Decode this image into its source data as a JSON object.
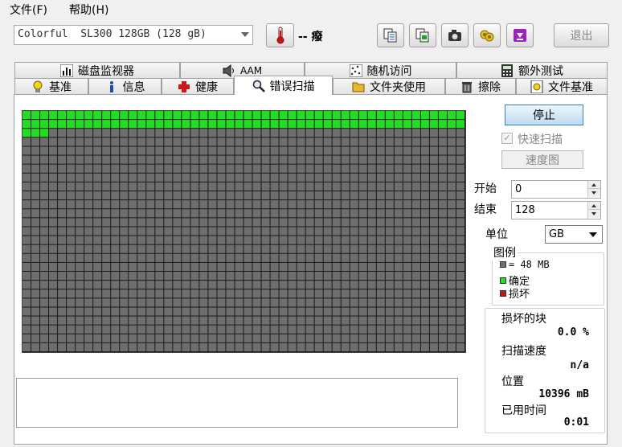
{
  "menu": {
    "file": "文件(F)",
    "help": "帮助(H)"
  },
  "toolbar": {
    "drive": "Colorful  SL300 128GB (128 gB)",
    "temperature": "-- 癈",
    "exit_label": "退出",
    "icons": [
      "thermometer-icon",
      "copy-text-icon",
      "copy-image-icon",
      "camera-icon",
      "options-icon",
      "download-icon"
    ]
  },
  "tabs_row1": [
    {
      "label": "磁盘监视器",
      "icon": "chart-icon"
    },
    {
      "label": "AAM",
      "icon": "speaker-icon"
    },
    {
      "label": "随机访问",
      "icon": "random-icon"
    },
    {
      "label": "额外测试",
      "icon": "calculator-icon"
    }
  ],
  "tabs_row2": [
    {
      "label": "基准",
      "icon": "lightbulb-icon"
    },
    {
      "label": "信息",
      "icon": "info-icon"
    },
    {
      "label": "健康",
      "icon": "health-cross-icon"
    },
    {
      "label": "错误扫描",
      "icon": "magnifier-icon",
      "active": true
    },
    {
      "label": "文件夹使用",
      "icon": "folder-icon"
    },
    {
      "label": "擦除",
      "icon": "trash-icon"
    },
    {
      "label": "文件基准",
      "icon": "file-benchmark-icon"
    }
  ],
  "scan": {
    "grid_columns": 50,
    "grid_rows": 27,
    "scanned_cells": 103,
    "colors": {
      "ok": "#22dd22",
      "pending": "#6e6e6e",
      "bad": "#cc1111",
      "line": "#1a1a1a"
    }
  },
  "controls": {
    "stop_label": "停止",
    "quick_scan_label": "快速扫描",
    "quick_scan_checked": true,
    "speed_map_label": "速度图",
    "start_label": "开始",
    "start_value": "0",
    "end_label": "结束",
    "end_value": "128",
    "unit_label": "单位",
    "unit_value": "GB"
  },
  "legend": {
    "title": "图例",
    "block_size": "= 48 MB",
    "ok": "确定",
    "bad": "损坏"
  },
  "stats": {
    "damaged_blocks_label": "损坏的块",
    "damaged_blocks_value": "0.0 %",
    "scan_speed_label": "扫描速度",
    "scan_speed_value": "n/a",
    "position_label": "位置",
    "position_value": "10396 mB",
    "elapsed_label": "已用时间",
    "elapsed_value": "0:01"
  }
}
